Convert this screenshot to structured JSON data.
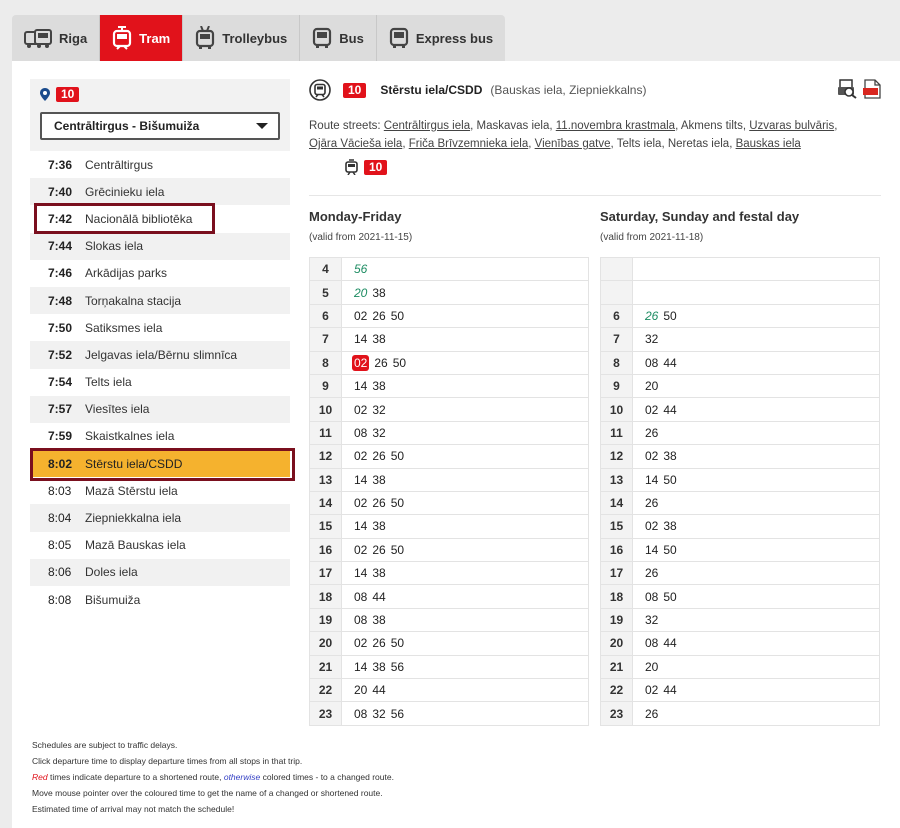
{
  "tabs": [
    {
      "label": "Riga",
      "icon": "riga-transport-icon",
      "active": false
    },
    {
      "label": "Tram",
      "icon": "tram-icon",
      "active": true
    },
    {
      "label": "Trolleybus",
      "icon": "trolleybus-icon",
      "active": false
    },
    {
      "label": "Bus",
      "icon": "bus-icon",
      "active": false
    },
    {
      "label": "Express bus",
      "icon": "express-bus-icon",
      "active": false
    }
  ],
  "route": {
    "number": "10",
    "direction": "Centrāltirgus - Bišumuiža",
    "stops": [
      {
        "time": "7:36",
        "name": "Centrāltirgus"
      },
      {
        "time": "7:40",
        "name": "Grēcinieku iela"
      },
      {
        "time": "7:42",
        "name": "Nacionālā bibliotēka"
      },
      {
        "time": "7:44",
        "name": "Slokas iela"
      },
      {
        "time": "7:46",
        "name": "Arkādijas parks"
      },
      {
        "time": "7:48",
        "name": "Torņakalna stacija"
      },
      {
        "time": "7:50",
        "name": "Satiksmes iela"
      },
      {
        "time": "7:52",
        "name": "Jelgavas iela/Bērnu slimnīca"
      },
      {
        "time": "7:54",
        "name": "Telts iela"
      },
      {
        "time": "7:57",
        "name": "Viesītes iela"
      },
      {
        "time": "7:59",
        "name": "Skaistkalnes iela"
      },
      {
        "time": "8:02",
        "name": "Stērstu iela/CSDD"
      },
      {
        "time": "8:03",
        "name": "Mazā Stērstu iela"
      },
      {
        "time": "8:04",
        "name": "Ziepniekkalna iela"
      },
      {
        "time": "8:05",
        "name": "Mazā Bauskas iela"
      },
      {
        "time": "8:06",
        "name": "Doles iela"
      },
      {
        "time": "8:08",
        "name": "Bišumuiža"
      }
    ]
  },
  "stop": {
    "name": "Stērstu iela/CSDD",
    "subtitle": "(Bauskas iela, Ziepniekkalns)",
    "route_streets_label": "Route streets:",
    "route_streets": [
      {
        "text": "Centrāltirgus iela",
        "link": true
      },
      {
        "text": "Maskavas iela",
        "link": false
      },
      {
        "text": "11.novembra krastmala",
        "link": true
      },
      {
        "text": "Akmens tilts",
        "link": false
      },
      {
        "text": "Uzvaras bulvāris",
        "link": true
      },
      {
        "text": "Ojāra Vācieša iela",
        "link": true
      },
      {
        "text": "Friča Brīvzemnieka iela",
        "link": true
      },
      {
        "text": "Vienības gatve",
        "link": true
      },
      {
        "text": "Telts iela",
        "link": false
      },
      {
        "text": "Neretas iela",
        "link": false
      },
      {
        "text": "Bauskas iela",
        "link": true
      }
    ],
    "connection_route": "10"
  },
  "schedules": {
    "weekday": {
      "title": "Monday-Friday",
      "valid": "(valid from 2021-11-15)",
      "rows": [
        {
          "hour": "4",
          "mins": [
            {
              "v": "56",
              "s": "green"
            }
          ]
        },
        {
          "hour": "5",
          "mins": [
            {
              "v": "20",
              "s": "green"
            },
            {
              "v": "38"
            }
          ]
        },
        {
          "hour": "6",
          "mins": [
            {
              "v": "02"
            },
            {
              "v": "26"
            },
            {
              "v": "50"
            }
          ]
        },
        {
          "hour": "7",
          "mins": [
            {
              "v": "14"
            },
            {
              "v": "38"
            }
          ]
        },
        {
          "hour": "8",
          "mins": [
            {
              "v": "02",
              "s": "sel"
            },
            {
              "v": "26"
            },
            {
              "v": "50"
            }
          ]
        },
        {
          "hour": "9",
          "mins": [
            {
              "v": "14"
            },
            {
              "v": "38"
            }
          ]
        },
        {
          "hour": "10",
          "mins": [
            {
              "v": "02"
            },
            {
              "v": "32"
            }
          ]
        },
        {
          "hour": "11",
          "mins": [
            {
              "v": "08"
            },
            {
              "v": "32"
            }
          ]
        },
        {
          "hour": "12",
          "mins": [
            {
              "v": "02"
            },
            {
              "v": "26"
            },
            {
              "v": "50"
            }
          ]
        },
        {
          "hour": "13",
          "mins": [
            {
              "v": "14"
            },
            {
              "v": "38"
            }
          ]
        },
        {
          "hour": "14",
          "mins": [
            {
              "v": "02"
            },
            {
              "v": "26"
            },
            {
              "v": "50"
            }
          ]
        },
        {
          "hour": "15",
          "mins": [
            {
              "v": "14"
            },
            {
              "v": "38"
            }
          ]
        },
        {
          "hour": "16",
          "mins": [
            {
              "v": "02"
            },
            {
              "v": "26"
            },
            {
              "v": "50"
            }
          ]
        },
        {
          "hour": "17",
          "mins": [
            {
              "v": "14"
            },
            {
              "v": "38"
            }
          ]
        },
        {
          "hour": "18",
          "mins": [
            {
              "v": "08"
            },
            {
              "v": "44"
            }
          ]
        },
        {
          "hour": "19",
          "mins": [
            {
              "v": "08"
            },
            {
              "v": "38"
            }
          ]
        },
        {
          "hour": "20",
          "mins": [
            {
              "v": "02"
            },
            {
              "v": "26"
            },
            {
              "v": "50"
            }
          ]
        },
        {
          "hour": "21",
          "mins": [
            {
              "v": "14"
            },
            {
              "v": "38"
            },
            {
              "v": "56"
            }
          ]
        },
        {
          "hour": "22",
          "mins": [
            {
              "v": "20"
            },
            {
              "v": "44"
            }
          ]
        },
        {
          "hour": "23",
          "mins": [
            {
              "v": "08"
            },
            {
              "v": "32"
            },
            {
              "v": "56"
            }
          ]
        }
      ]
    },
    "weekend": {
      "title": "Saturday, Sunday and festal day",
      "valid": "(valid from 2021-11-18)",
      "rows": [
        {
          "hour": "",
          "mins": []
        },
        {
          "hour": "",
          "mins": []
        },
        {
          "hour": "6",
          "mins": [
            {
              "v": "26",
              "s": "green"
            },
            {
              "v": "50"
            }
          ]
        },
        {
          "hour": "7",
          "mins": [
            {
              "v": "32"
            }
          ]
        },
        {
          "hour": "8",
          "mins": [
            {
              "v": "08"
            },
            {
              "v": "44"
            }
          ]
        },
        {
          "hour": "9",
          "mins": [
            {
              "v": "20"
            }
          ]
        },
        {
          "hour": "10",
          "mins": [
            {
              "v": "02"
            },
            {
              "v": "44"
            }
          ]
        },
        {
          "hour": "11",
          "mins": [
            {
              "v": "26"
            }
          ]
        },
        {
          "hour": "12",
          "mins": [
            {
              "v": "02"
            },
            {
              "v": "38"
            }
          ]
        },
        {
          "hour": "13",
          "mins": [
            {
              "v": "14"
            },
            {
              "v": "50"
            }
          ]
        },
        {
          "hour": "14",
          "mins": [
            {
              "v": "26"
            }
          ]
        },
        {
          "hour": "15",
          "mins": [
            {
              "v": "02"
            },
            {
              "v": "38"
            }
          ]
        },
        {
          "hour": "16",
          "mins": [
            {
              "v": "14"
            },
            {
              "v": "50"
            }
          ]
        },
        {
          "hour": "17",
          "mins": [
            {
              "v": "26"
            }
          ]
        },
        {
          "hour": "18",
          "mins": [
            {
              "v": "08"
            },
            {
              "v": "50"
            }
          ]
        },
        {
          "hour": "19",
          "mins": [
            {
              "v": "32"
            }
          ]
        },
        {
          "hour": "20",
          "mins": [
            {
              "v": "08"
            },
            {
              "v": "44"
            }
          ]
        },
        {
          "hour": "21",
          "mins": [
            {
              "v": "20"
            }
          ]
        },
        {
          "hour": "22",
          "mins": [
            {
              "v": "02"
            },
            {
              "v": "44"
            }
          ]
        },
        {
          "hour": "23",
          "mins": [
            {
              "v": "26"
            }
          ]
        }
      ]
    }
  },
  "notes": {
    "line1": "Schedules are subject to traffic delays.",
    "line2": "Click departure time to display departure times from all stops in that trip.",
    "line3_red": "Red",
    "line3_mid": " times indicate departure to a shortened route, ",
    "line3_other": "otherwise",
    "line3_end": " colored times - to a changed route.",
    "line4": "Move mouse pointer over the coloured time to get the name of a changed or shortened route.",
    "line5": "Estimated time of arrival may not match the schedule!"
  },
  "colors": {
    "accent": "#e1121b",
    "current_stop": "#f5b22e",
    "highlight_box": "#7a0f1e",
    "changed_time": "#1d8c62"
  }
}
